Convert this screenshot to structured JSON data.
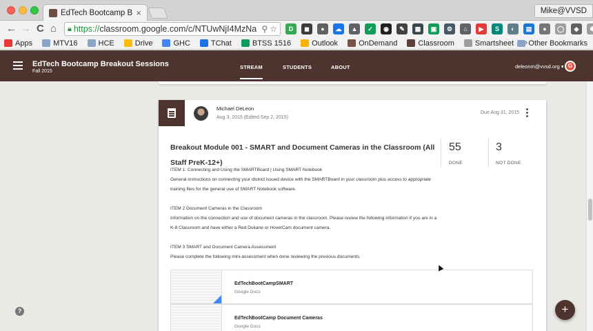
{
  "browser": {
    "tab_title": "EdTech Bootcamp Breakout",
    "tab_close": "×",
    "profile": "Mike@VVSD",
    "url_protocol": "https://",
    "url_rest": "classroom.google.com/c/NTUwNjI4MzNa",
    "back": "←",
    "forward": "→",
    "reload": "C",
    "home": "⌂",
    "zoom_icon": "🔍",
    "star_icon": "☆",
    "extensions": [
      {
        "color": "#34a853",
        "glyph": "D"
      },
      {
        "color": "#3c3c3c",
        "glyph": "◼"
      },
      {
        "color": "#616161",
        "glyph": "●"
      },
      {
        "color": "#1a73e8",
        "glyph": "☁"
      },
      {
        "color": "#5f6368",
        "glyph": "▲"
      },
      {
        "color": "#0f9d58",
        "glyph": "✓"
      },
      {
        "color": "#212121",
        "glyph": "◉"
      },
      {
        "color": "#424242",
        "glyph": "✎"
      },
      {
        "color": "#37474f",
        "glyph": "▦"
      },
      {
        "color": "#0f9d58",
        "glyph": "▣"
      },
      {
        "color": "#455a64",
        "glyph": "⚙"
      },
      {
        "color": "#5f6368",
        "glyph": "⌂"
      },
      {
        "color": "#e53935",
        "glyph": "▶"
      },
      {
        "color": "#00897b",
        "glyph": "S"
      },
      {
        "color": "#607d8b",
        "glyph": "◐"
      },
      {
        "color": "#1976d2",
        "glyph": "▤"
      },
      {
        "color": "#757575",
        "glyph": "●"
      },
      {
        "color": "#9e9e9e",
        "glyph": "◯"
      },
      {
        "color": "#616161",
        "glyph": "◆"
      },
      {
        "color": "#9e9e9e",
        "glyph": "✱"
      }
    ]
  },
  "bookmarks": {
    "items": [
      {
        "label": "Apps",
        "color": "#e53935"
      },
      {
        "label": "MTV16",
        "color": "#8aa4c8"
      },
      {
        "label": "HCE",
        "color": "#8aa4c8"
      },
      {
        "label": "Drive",
        "color": "#fbbc05"
      },
      {
        "label": "GHC",
        "color": "#4285f4"
      },
      {
        "label": "TChat",
        "color": "#1a73e8"
      },
      {
        "label": "BTSS 1516",
        "color": "#0f9d58"
      },
      {
        "label": "Outlook",
        "color": "#f4b400"
      },
      {
        "label": "OnDemand",
        "color": "#795548"
      },
      {
        "label": "Classroom",
        "color": "#5d4037"
      },
      {
        "label": "Smartsheet",
        "color": "#9e9e9e"
      }
    ],
    "more": "»",
    "other": "Other Bookmarks"
  },
  "app": {
    "class_title": "EdTech Bootcamp Breakout Sessions",
    "class_subtitle": "Fall 2015",
    "tabs": {
      "stream": "STREAM",
      "students": "STUDENTS",
      "about": "ABOUT"
    },
    "user_email": "deleonm@vvsd.org ▾",
    "avatar_letter": "G"
  },
  "post": {
    "author": "Michael DeLeon",
    "date": "Aug 3, 2015 (Edited Sep 2, 2015)",
    "due": "Due Aug 31, 2015",
    "title": "Breakout Module 001 - SMART and Document Cameras in the Classroom (All Staff PreK-12+)",
    "done_count": "55",
    "done_label": "DONE",
    "not_done_count": "3",
    "not_done_label": "NOT DONE",
    "body": [
      "ITEM 1: Connecting and Using the SMARTBoard | Using SMART Notebook",
      "General instructions on connecting your district issued device with the SMARTBoard in your classroom plus access to appropriate training files for the general use of SMART Notebook software.",
      "ITEM 2 Document Cameras in the Classroom",
      "Information on the connection and use of document cameras in the classroom. Please review the following information if you are in a K-8 Classroom and have either a Red Dukane or HoverCam document camera.",
      "ITEM 3 SMART and Document Camera Assessment",
      "Please complete the following mini-assessment when done reviewing the previous documents."
    ],
    "attachments": [
      {
        "title": "EdTechBootCampSMART",
        "type": "Google Docs"
      },
      {
        "title": "EdTechBootCamp Document Cameras",
        "type": "Google Docs"
      }
    ]
  },
  "help_label": "?",
  "fab_label": "+"
}
